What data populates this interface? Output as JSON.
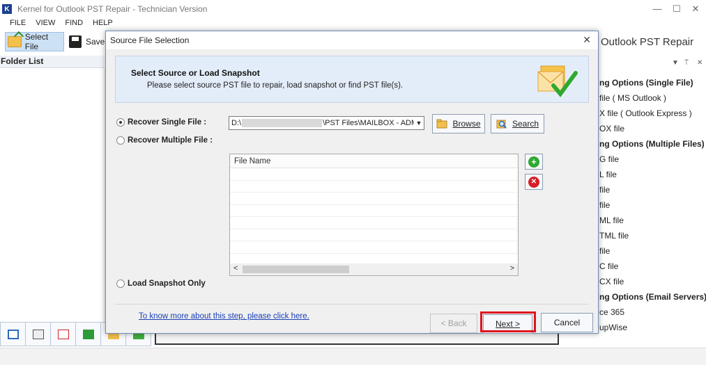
{
  "window": {
    "title": "Kernel for Outlook PST Repair - Technician Version",
    "icon_letter": "K",
    "minimize": "—",
    "maximize": "☐",
    "close": "✕"
  },
  "menu": [
    "FILE",
    "VIEW",
    "FIND",
    "HELP"
  ],
  "toolbar": {
    "select_file": "Select File",
    "save": "Save"
  },
  "app_heading": "Outlook PST Repair",
  "left_panel": {
    "title": "Folder List"
  },
  "right_panel": {
    "header_icons": [
      "▼",
      "⍑",
      "✕"
    ],
    "items": [
      {
        "text": "ng Options (Single File)",
        "group": true
      },
      {
        "text": "file ( MS Outlook )",
        "group": false
      },
      {
        "text": "X file ( Outlook Express )",
        "group": false
      },
      {
        "text": "OX file",
        "group": false
      },
      {
        "text": "ng Options (Multiple Files)",
        "group": true
      },
      {
        "text": "G file",
        "group": false
      },
      {
        "text": "L file",
        "group": false
      },
      {
        "text": "file",
        "group": false
      },
      {
        "text": "file",
        "group": false
      },
      {
        "text": "ML file",
        "group": false
      },
      {
        "text": "TML file",
        "group": false
      },
      {
        "text": "file",
        "group": false
      },
      {
        "text": "C file",
        "group": false
      },
      {
        "text": "CX file",
        "group": false
      },
      {
        "text": "ng Options (Email Servers)",
        "group": true
      },
      {
        "text": "ce 365",
        "group": false
      },
      {
        "text": "upWise",
        "group": false
      }
    ]
  },
  "dialog": {
    "title": "Source File Selection",
    "close": "✕",
    "banner_heading": "Select Source or Load Snapshot",
    "banner_sub": "Please select source PST file to repair, load snapshot or find PST file(s).",
    "recover_single": "Recover Single File :",
    "recover_multiple": "Recover Multiple File :",
    "load_snapshot": "Load Snapshot Only",
    "path_prefix": "D:\\",
    "path_suffix": "\\PST Files\\MAILBOX - ADM",
    "browse": "Browse",
    "search": "Search",
    "table_header": "File Name",
    "add_symbol": "+",
    "remove_symbol": "✕",
    "help_link": "To know more about this step, please click here.",
    "back": "< Back",
    "next": "Next >",
    "cancel": "Cancel"
  },
  "colors": {
    "accent": "#1b3f8f",
    "banner_bg": "#e3edf9",
    "highlight": "#e0141e",
    "link": "#1a3fb5"
  }
}
